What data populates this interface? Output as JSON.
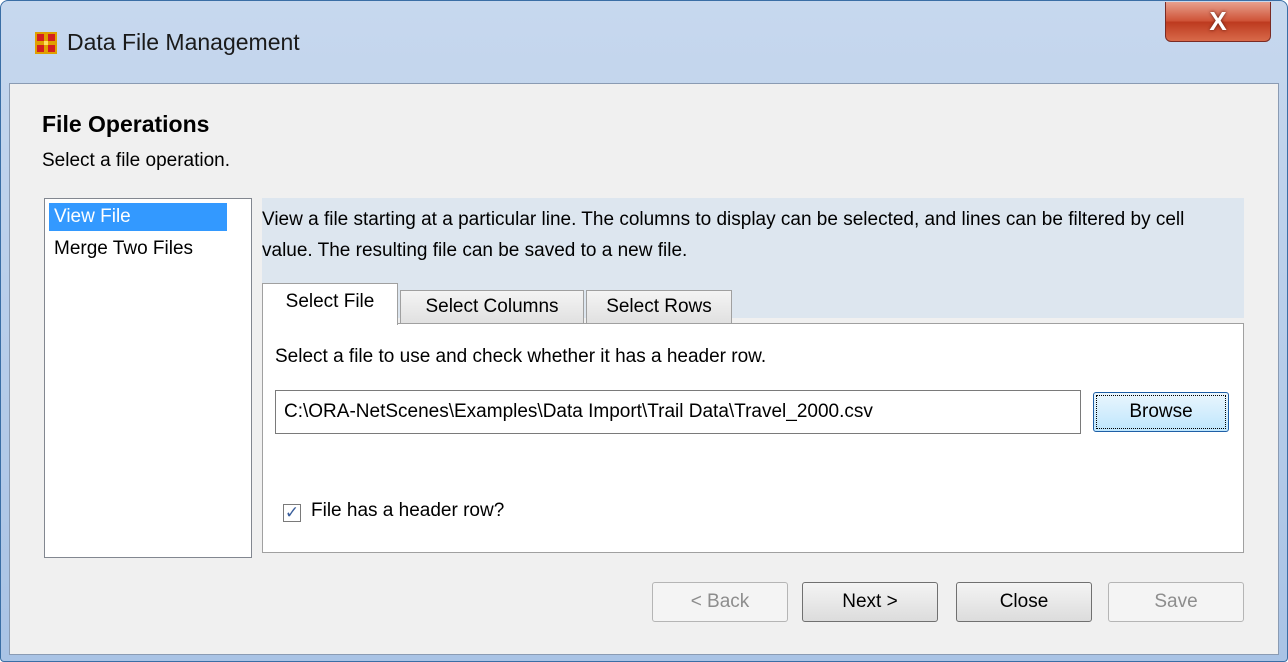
{
  "window": {
    "title": "Data File Management",
    "close_label": "X"
  },
  "header": {
    "heading": "File Operations",
    "subheading": "Select a file operation."
  },
  "operations": [
    {
      "label": "View File",
      "selected": true
    },
    {
      "label": "Merge Two Files",
      "selected": false
    }
  ],
  "description": "View a file starting at a particular line. The columns to display can be selected, and lines can be filtered by cell value. The resulting file can be saved to a new file.",
  "tabs": [
    {
      "label": "Select File",
      "active": true
    },
    {
      "label": "Select Columns",
      "active": false
    },
    {
      "label": "Select Rows",
      "active": false
    }
  ],
  "select_file": {
    "instruction": "Select a file to use and check whether it has a header row.",
    "path_value": "C:\\ORA-NetScenes\\Examples\\Data Import\\Trail Data\\Travel_2000.csv",
    "browse_label": "Browse",
    "header_checkbox_label": "File has a header row?",
    "header_checked": true
  },
  "footer": {
    "back_label": "< Back",
    "next_label": "Next >",
    "close_label": "Close",
    "save_label": "Save"
  },
  "colors": {
    "selection": "#3399ff",
    "title_bar": "#a9c3e5",
    "close_button": "#cf5438"
  }
}
